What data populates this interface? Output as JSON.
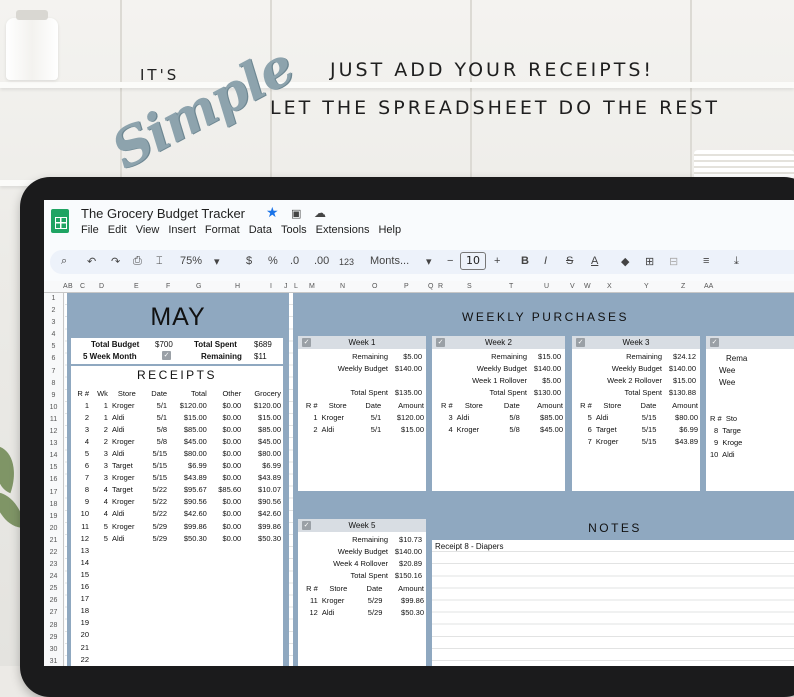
{
  "header": {
    "its": "IT'S",
    "simple": "Simple",
    "line1": "JUST ADD YOUR RECEIPTS!",
    "line2": "LET THE SPREADSHEET DO THE REST"
  },
  "app": {
    "title": "The Grocery Budget Tracker",
    "menu": [
      "File",
      "Edit",
      "View",
      "Insert",
      "Format",
      "Data",
      "Tools",
      "Extensions",
      "Help"
    ],
    "zoom": "75%",
    "currency": "$",
    "percent": "%",
    "dec_dec": ".0",
    "dec_inc": ".00",
    "num_fmt": "123",
    "font": "Monts...",
    "font_size": "10"
  },
  "columns": [
    "A",
    "B",
    "C",
    "D",
    "E",
    "F",
    "G",
    "H",
    "I",
    "J",
    "L",
    "M",
    "N",
    "O",
    "P",
    "Q",
    "R",
    "S",
    "T",
    "U",
    "V",
    "W",
    "X",
    "Y",
    "Z",
    "AA"
  ],
  "rows": [
    "1",
    "2",
    "3",
    "4",
    "5",
    "6",
    "7",
    "8",
    "9",
    "10",
    "11",
    "12",
    "13",
    "14",
    "15",
    "16",
    "17",
    "18",
    "19",
    "20",
    "21",
    "22",
    "23",
    "24",
    "25",
    "26",
    "27",
    "28",
    "29",
    "30",
    "31"
  ],
  "summary": {
    "month": "MAY",
    "total_budget_label": "Total Budget",
    "total_budget": "$700",
    "total_spent_label": "Total Spent",
    "total_spent": "$689",
    "five_week_label": "5 Week Month",
    "remaining_label": "Remaining",
    "remaining": "$11"
  },
  "receipts": {
    "title": "RECEIPTS",
    "headers": [
      "R #",
      "Wk",
      "Store",
      "Date",
      "Total",
      "Other",
      "Grocery"
    ],
    "rows": [
      [
        "1",
        "1",
        "Kroger",
        "5/1",
        "$120.00",
        "$0.00",
        "$120.00"
      ],
      [
        "2",
        "1",
        "Aldi",
        "5/1",
        "$15.00",
        "$0.00",
        "$15.00"
      ],
      [
        "3",
        "2",
        "Aldi",
        "5/8",
        "$85.00",
        "$0.00",
        "$85.00"
      ],
      [
        "4",
        "2",
        "Kroger",
        "5/8",
        "$45.00",
        "$0.00",
        "$45.00"
      ],
      [
        "5",
        "3",
        "Aldi",
        "5/15",
        "$80.00",
        "$0.00",
        "$80.00"
      ],
      [
        "6",
        "3",
        "Target",
        "5/15",
        "$6.99",
        "$0.00",
        "$6.99"
      ],
      [
        "7",
        "3",
        "Kroger",
        "5/15",
        "$43.89",
        "$0.00",
        "$43.89"
      ],
      [
        "8",
        "4",
        "Target",
        "5/22",
        "$95.67",
        "$85.60",
        "$10.07"
      ],
      [
        "9",
        "4",
        "Kroger",
        "5/22",
        "$90.56",
        "$0.00",
        "$90.56"
      ],
      [
        "10",
        "4",
        "Aldi",
        "5/22",
        "$42.60",
        "$0.00",
        "$42.60"
      ],
      [
        "11",
        "5",
        "Kroger",
        "5/29",
        "$99.86",
        "$0.00",
        "$99.86"
      ],
      [
        "12",
        "5",
        "Aldi",
        "5/29",
        "$50.30",
        "$0.00",
        "$50.30"
      ]
    ],
    "empty_rows": [
      "13",
      "14",
      "15",
      "16",
      "17",
      "18",
      "19",
      "20",
      "21",
      "22"
    ]
  },
  "weekly": {
    "title": "WEEKLY PURCHASES",
    "week1": {
      "title": "Week 1",
      "kv": [
        [
          "Remaining",
          "$5.00"
        ],
        [
          "Weekly Budget",
          "$140.00"
        ],
        [
          "",
          ""
        ],
        [
          "Total Spent",
          "$135.00"
        ]
      ],
      "headers": [
        "R #",
        "Store",
        "Date",
        "Amount"
      ],
      "rows": [
        [
          "1",
          "Kroger",
          "5/1",
          "$120.00"
        ],
        [
          "2",
          "Aldi",
          "5/1",
          "$15.00"
        ]
      ]
    },
    "week2": {
      "title": "Week 2",
      "kv": [
        [
          "Remaining",
          "$15.00"
        ],
        [
          "Weekly Budget",
          "$140.00"
        ],
        [
          "Week 1 Rollover",
          "$5.00"
        ],
        [
          "Total Spent",
          "$130.00"
        ]
      ],
      "headers": [
        "R #",
        "Store",
        "Date",
        "Amount"
      ],
      "rows": [
        [
          "3",
          "Aldi",
          "5/8",
          "$85.00"
        ],
        [
          "4",
          "Kroger",
          "5/8",
          "$45.00"
        ]
      ]
    },
    "week3": {
      "title": "Week 3",
      "kv": [
        [
          "Remaining",
          "$24.12"
        ],
        [
          "Weekly Budget",
          "$140.00"
        ],
        [
          "Week 2 Rollover",
          "$15.00"
        ],
        [
          "Total Spent",
          "$130.88"
        ]
      ],
      "headers": [
        "R #",
        "Store",
        "Date",
        "Amount"
      ],
      "rows": [
        [
          "5",
          "Aldi",
          "5/15",
          "$80.00"
        ],
        [
          "6",
          "Target",
          "5/15",
          "$6.99"
        ],
        [
          "7",
          "Kroger",
          "5/15",
          "$43.89"
        ]
      ]
    },
    "week4_partial": {
      "kv": [
        "Rema",
        "Wee",
        "Wee"
      ],
      "header": "R #  Sto",
      "rows": [
        "8  Targe",
        "9  Kroge",
        "10  Aldi"
      ]
    },
    "week5": {
      "title": "Week 5",
      "kv": [
        [
          "Remaining",
          "$10.73"
        ],
        [
          "Weekly Budget",
          "$140.00"
        ],
        [
          "Week 4 Rollover",
          "$20.89"
        ],
        [
          "Total Spent",
          "$150.16"
        ]
      ],
      "headers": [
        "R #",
        "Store",
        "Date",
        "Amount"
      ],
      "rows": [
        [
          "11",
          "Kroger",
          "5/29",
          "$99.86"
        ],
        [
          "12",
          "Aldi",
          "5/29",
          "$50.30"
        ]
      ]
    }
  },
  "notes": {
    "title": "NOTES",
    "text": "Receipt 8 - Diapers"
  }
}
